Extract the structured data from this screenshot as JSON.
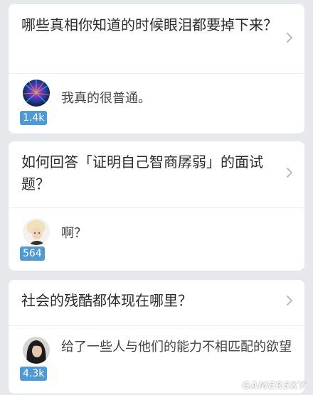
{
  "cards": [
    {
      "question": "哪些真相你知道的时候眼泪都要掉下来？",
      "answer": "我真的很普通。",
      "votes": "1.4k"
    },
    {
      "question": "如何回答「证明自己智商孱弱」的面试题？",
      "answer": "啊？",
      "votes": "564"
    },
    {
      "question": "社会的残酷都体现在哪里？",
      "answer": "给了一些人与他们的能力不相匹配的欲望",
      "votes": "4.3k"
    }
  ],
  "icons": {
    "chevron": "chevron-right-icon"
  },
  "colors": {
    "badge": "#4e9ad6",
    "background": "#e6e8ec"
  },
  "watermark": "GAMERSKY"
}
